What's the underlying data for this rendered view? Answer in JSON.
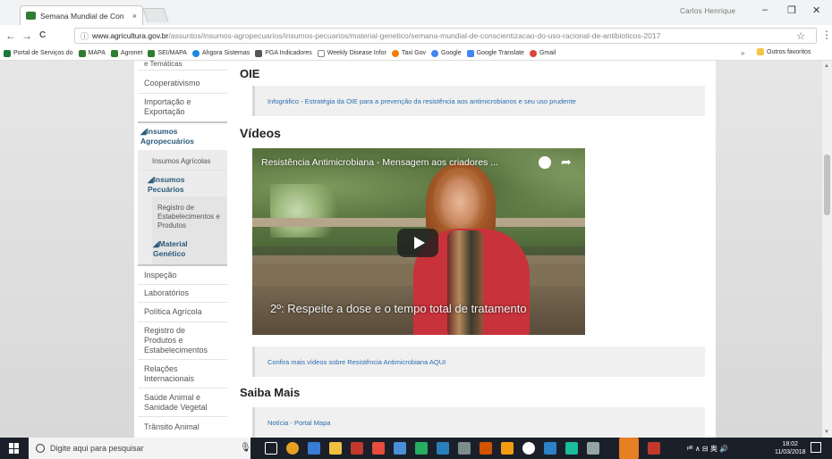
{
  "browser": {
    "tab_title": "Semana Mundial de Con",
    "tab_close": "×",
    "profile": "Carlos Henrique",
    "window_controls": {
      "minimize": "–",
      "maximize": "❐",
      "close": "✕"
    },
    "nav": {
      "back": "←",
      "forward": "→",
      "reload": "C",
      "info": "ⓘ"
    },
    "url_host": "www.agricultura.gov.br",
    "url_path": "/assuntos/insumos-agropecuarios/insumos-pecuarios/material-genetico/semana-mundial-de-conscientizacao-do-uso-racional-de-antibioticos-2017",
    "star": "☆",
    "menu": "⋮"
  },
  "bookmarks": [
    {
      "label": "Portal de Serviços do",
      "color": "#1a7a3a"
    },
    {
      "label": "MAPA",
      "color": "#2e7d32"
    },
    {
      "label": "Agronet",
      "color": "#2e7d32"
    },
    {
      "label": "SEI/MAPA",
      "color": "#2e7d32"
    },
    {
      "label": "Ahgora Sistemas",
      "color": "#1e88e5"
    },
    {
      "label": "PGA Indicadores",
      "color": "#555555"
    },
    {
      "label": "Weekly Disease Infor",
      "color": "#888888"
    },
    {
      "label": "Taxi Gov",
      "color": "#f57c00"
    },
    {
      "label": "Google",
      "color": "#4285f4"
    },
    {
      "label": "Google Translate",
      "color": "#4285f4"
    },
    {
      "label": "Gmail",
      "color": "#db4437"
    }
  ],
  "bookmarks_more": "»",
  "bookmarks_other": "Outros favoritos",
  "sidebar": {
    "top_partial": "e Temáticas",
    "items": [
      "Cooperativismo",
      "Importação e Exportação",
      "Insumos Agropecuários",
      "Insumos Agrícolas",
      "Insumos Pecuários",
      "Registro de Estabelecimentos e Produtos",
      "Material Genético",
      "Inspeção",
      "Laboratórios",
      "Política Agrícola",
      "Registro de Produtos e Estabelecimentos",
      "Relações Internacionais",
      "Saúde Animal e Sanidade Vegetal",
      "Trânsito Animal"
    ]
  },
  "main": {
    "oie_heading": "OIE",
    "oie_link": "Infográfico - Estratégia da OIE para a prevenção da resistência aos antimicrobianos e seu uso prudente",
    "videos_heading": "Vídeos",
    "video_title": "Resistência Antimicrobiana - Mensagem aos criadores ...",
    "video_caption": "2º: Respeite a dose e o tempo total de tratamento",
    "videos_link": "Confira mais vídeos sobre Resistência Antimicrobiana AQUI",
    "saiba_heading": "Saiba Mais",
    "saiba_link": "Notícia - Portal Mapa"
  },
  "taskbar": {
    "search_placeholder": "Digite aqui para pesquisar",
    "time": "18:02",
    "date": "11/03/2018",
    "tray": "ᵖᴿ ∧ ⊟ 奥 🔊"
  }
}
